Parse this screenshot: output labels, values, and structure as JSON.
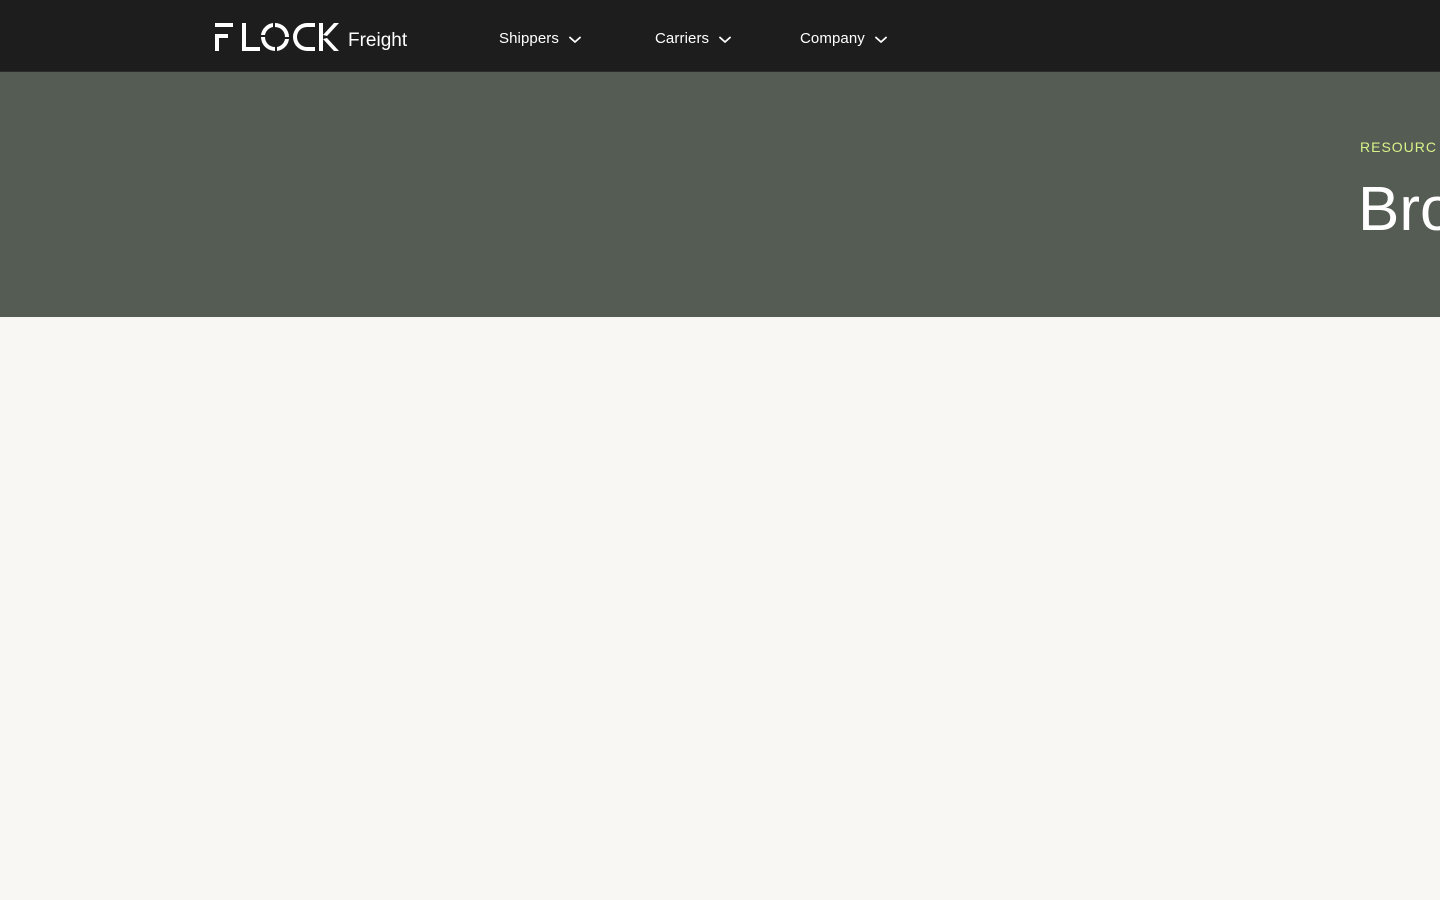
{
  "header": {
    "logo": {
      "wordmark": "FLOCK",
      "subtitle": "Freight"
    },
    "nav": [
      {
        "label": "Shippers",
        "icon": "chevron-down-icon"
      },
      {
        "label": "Carriers",
        "icon": "chevron-down-icon"
      },
      {
        "label": "Company",
        "icon": "chevron-down-icon"
      }
    ]
  },
  "hero": {
    "eyebrow": "RESOURC",
    "title": "Bro"
  },
  "colors": {
    "nav_background": "#1d1d1d",
    "hero_background": "#555c53",
    "eyebrow_accent": "#d8f28a",
    "page_background": "#f8f7f3"
  }
}
